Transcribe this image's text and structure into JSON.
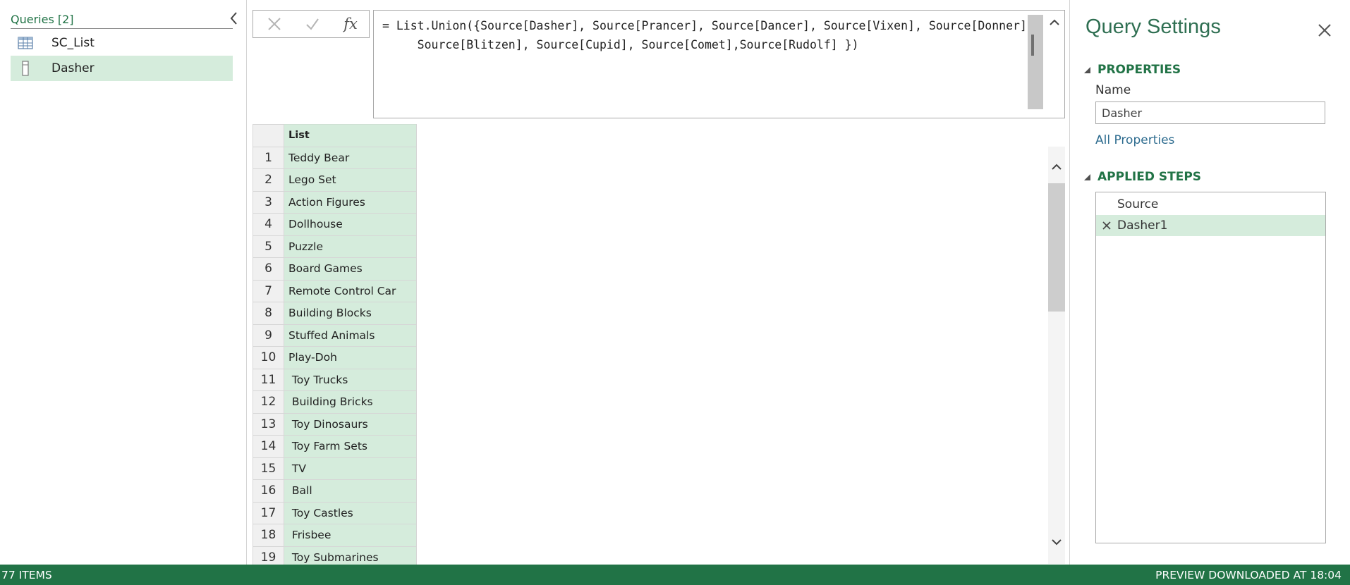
{
  "queries": {
    "title": "Queries [2]",
    "items": [
      {
        "label": "SC_List",
        "icon": "table-icon"
      },
      {
        "label": "Dasher",
        "icon": "list-icon"
      }
    ]
  },
  "formula": {
    "cancel_icon": "cancel-x-icon",
    "commit_icon": "checkmark-icon",
    "fx_label": "fx",
    "text": "= List.Union({Source[Dasher], Source[Prancer], Source[Dancer], Source[Vixen], Source[Donner],\n     Source[Blitzen], Source[Cupid], Source[Comet],Source[Rudolf] })"
  },
  "grid": {
    "column_header": "List",
    "rows": [
      {
        "n": "1",
        "value": "Teddy Bear"
      },
      {
        "n": "2",
        "value": "Lego Set"
      },
      {
        "n": "3",
        "value": "Action Figures"
      },
      {
        "n": "4",
        "value": "Dollhouse"
      },
      {
        "n": "5",
        "value": "Puzzle"
      },
      {
        "n": "6",
        "value": "Board Games"
      },
      {
        "n": "7",
        "value": "Remote Control Car"
      },
      {
        "n": "8",
        "value": "Building Blocks"
      },
      {
        "n": "9",
        "value": "Stuffed Animals"
      },
      {
        "n": "10",
        "value": "Play-Doh"
      },
      {
        "n": "11",
        "value": " Toy Trucks"
      },
      {
        "n": "12",
        "value": " Building Bricks"
      },
      {
        "n": "13",
        "value": " Toy Dinosaurs"
      },
      {
        "n": "14",
        "value": " Toy Farm Sets"
      },
      {
        "n": "15",
        "value": " TV"
      },
      {
        "n": "16",
        "value": " Ball"
      },
      {
        "n": "17",
        "value": " Toy Castles"
      },
      {
        "n": "18",
        "value": " Frisbee"
      },
      {
        "n": "19",
        "value": " Toy Submarines"
      }
    ]
  },
  "settings": {
    "title": "Query Settings",
    "properties_header": "PROPERTIES",
    "name_label": "Name",
    "name_value": "Dasher",
    "all_properties_link": "All Properties",
    "applied_steps_header": "APPLIED STEPS",
    "steps": [
      {
        "label": "Source",
        "selected": false
      },
      {
        "label": "Dasher1",
        "selected": true
      }
    ]
  },
  "status": {
    "items_count": "77 ITEMS",
    "preview_text": "PREVIEW DOWNLOADED AT 18:04"
  },
  "colors": {
    "accent_green": "#217346",
    "selection_green": "#d5ecdc"
  }
}
